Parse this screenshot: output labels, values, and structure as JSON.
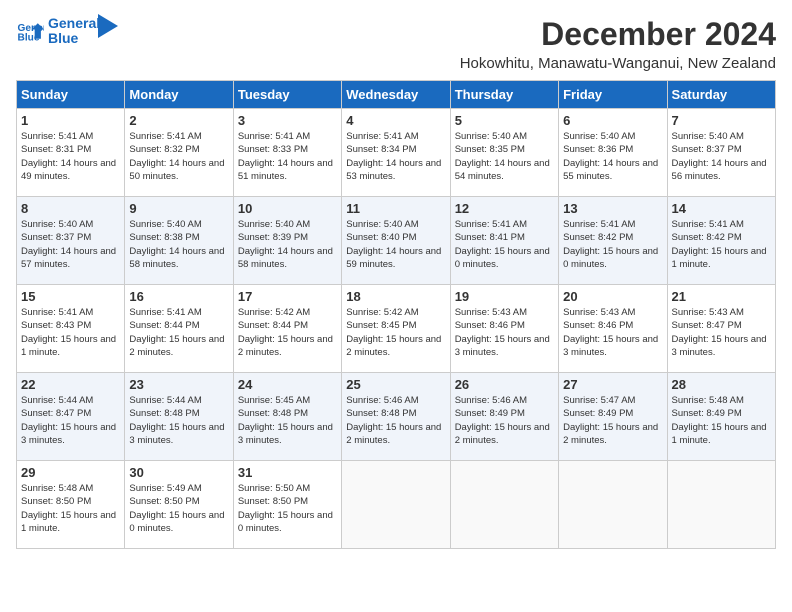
{
  "header": {
    "logo_line1": "General",
    "logo_line2": "Blue",
    "month": "December 2024",
    "location": "Hokowhitu, Manawatu-Wanganui, New Zealand"
  },
  "weekdays": [
    "Sunday",
    "Monday",
    "Tuesday",
    "Wednesday",
    "Thursday",
    "Friday",
    "Saturday"
  ],
  "weeks": [
    [
      {
        "day": "1",
        "sunrise": "5:41 AM",
        "sunset": "8:31 PM",
        "daylight": "14 hours and 49 minutes."
      },
      {
        "day": "2",
        "sunrise": "5:41 AM",
        "sunset": "8:32 PM",
        "daylight": "14 hours and 50 minutes."
      },
      {
        "day": "3",
        "sunrise": "5:41 AM",
        "sunset": "8:33 PM",
        "daylight": "14 hours and 51 minutes."
      },
      {
        "day": "4",
        "sunrise": "5:41 AM",
        "sunset": "8:34 PM",
        "daylight": "14 hours and 53 minutes."
      },
      {
        "day": "5",
        "sunrise": "5:40 AM",
        "sunset": "8:35 PM",
        "daylight": "14 hours and 54 minutes."
      },
      {
        "day": "6",
        "sunrise": "5:40 AM",
        "sunset": "8:36 PM",
        "daylight": "14 hours and 55 minutes."
      },
      {
        "day": "7",
        "sunrise": "5:40 AM",
        "sunset": "8:37 PM",
        "daylight": "14 hours and 56 minutes."
      }
    ],
    [
      {
        "day": "8",
        "sunrise": "5:40 AM",
        "sunset": "8:37 PM",
        "daylight": "14 hours and 57 minutes."
      },
      {
        "day": "9",
        "sunrise": "5:40 AM",
        "sunset": "8:38 PM",
        "daylight": "14 hours and 58 minutes."
      },
      {
        "day": "10",
        "sunrise": "5:40 AM",
        "sunset": "8:39 PM",
        "daylight": "14 hours and 58 minutes."
      },
      {
        "day": "11",
        "sunrise": "5:40 AM",
        "sunset": "8:40 PM",
        "daylight": "14 hours and 59 minutes."
      },
      {
        "day": "12",
        "sunrise": "5:41 AM",
        "sunset": "8:41 PM",
        "daylight": "15 hours and 0 minutes."
      },
      {
        "day": "13",
        "sunrise": "5:41 AM",
        "sunset": "8:42 PM",
        "daylight": "15 hours and 0 minutes."
      },
      {
        "day": "14",
        "sunrise": "5:41 AM",
        "sunset": "8:42 PM",
        "daylight": "15 hours and 1 minute."
      }
    ],
    [
      {
        "day": "15",
        "sunrise": "5:41 AM",
        "sunset": "8:43 PM",
        "daylight": "15 hours and 1 minute."
      },
      {
        "day": "16",
        "sunrise": "5:41 AM",
        "sunset": "8:44 PM",
        "daylight": "15 hours and 2 minutes."
      },
      {
        "day": "17",
        "sunrise": "5:42 AM",
        "sunset": "8:44 PM",
        "daylight": "15 hours and 2 minutes."
      },
      {
        "day": "18",
        "sunrise": "5:42 AM",
        "sunset": "8:45 PM",
        "daylight": "15 hours and 2 minutes."
      },
      {
        "day": "19",
        "sunrise": "5:43 AM",
        "sunset": "8:46 PM",
        "daylight": "15 hours and 3 minutes."
      },
      {
        "day": "20",
        "sunrise": "5:43 AM",
        "sunset": "8:46 PM",
        "daylight": "15 hours and 3 minutes."
      },
      {
        "day": "21",
        "sunrise": "5:43 AM",
        "sunset": "8:47 PM",
        "daylight": "15 hours and 3 minutes."
      }
    ],
    [
      {
        "day": "22",
        "sunrise": "5:44 AM",
        "sunset": "8:47 PM",
        "daylight": "15 hours and 3 minutes."
      },
      {
        "day": "23",
        "sunrise": "5:44 AM",
        "sunset": "8:48 PM",
        "daylight": "15 hours and 3 minutes."
      },
      {
        "day": "24",
        "sunrise": "5:45 AM",
        "sunset": "8:48 PM",
        "daylight": "15 hours and 3 minutes."
      },
      {
        "day": "25",
        "sunrise": "5:46 AM",
        "sunset": "8:48 PM",
        "daylight": "15 hours and 2 minutes."
      },
      {
        "day": "26",
        "sunrise": "5:46 AM",
        "sunset": "8:49 PM",
        "daylight": "15 hours and 2 minutes."
      },
      {
        "day": "27",
        "sunrise": "5:47 AM",
        "sunset": "8:49 PM",
        "daylight": "15 hours and 2 minutes."
      },
      {
        "day": "28",
        "sunrise": "5:48 AM",
        "sunset": "8:49 PM",
        "daylight": "15 hours and 1 minute."
      }
    ],
    [
      {
        "day": "29",
        "sunrise": "5:48 AM",
        "sunset": "8:50 PM",
        "daylight": "15 hours and 1 minute."
      },
      {
        "day": "30",
        "sunrise": "5:49 AM",
        "sunset": "8:50 PM",
        "daylight": "15 hours and 0 minutes."
      },
      {
        "day": "31",
        "sunrise": "5:50 AM",
        "sunset": "8:50 PM",
        "daylight": "15 hours and 0 minutes."
      },
      null,
      null,
      null,
      null
    ]
  ]
}
